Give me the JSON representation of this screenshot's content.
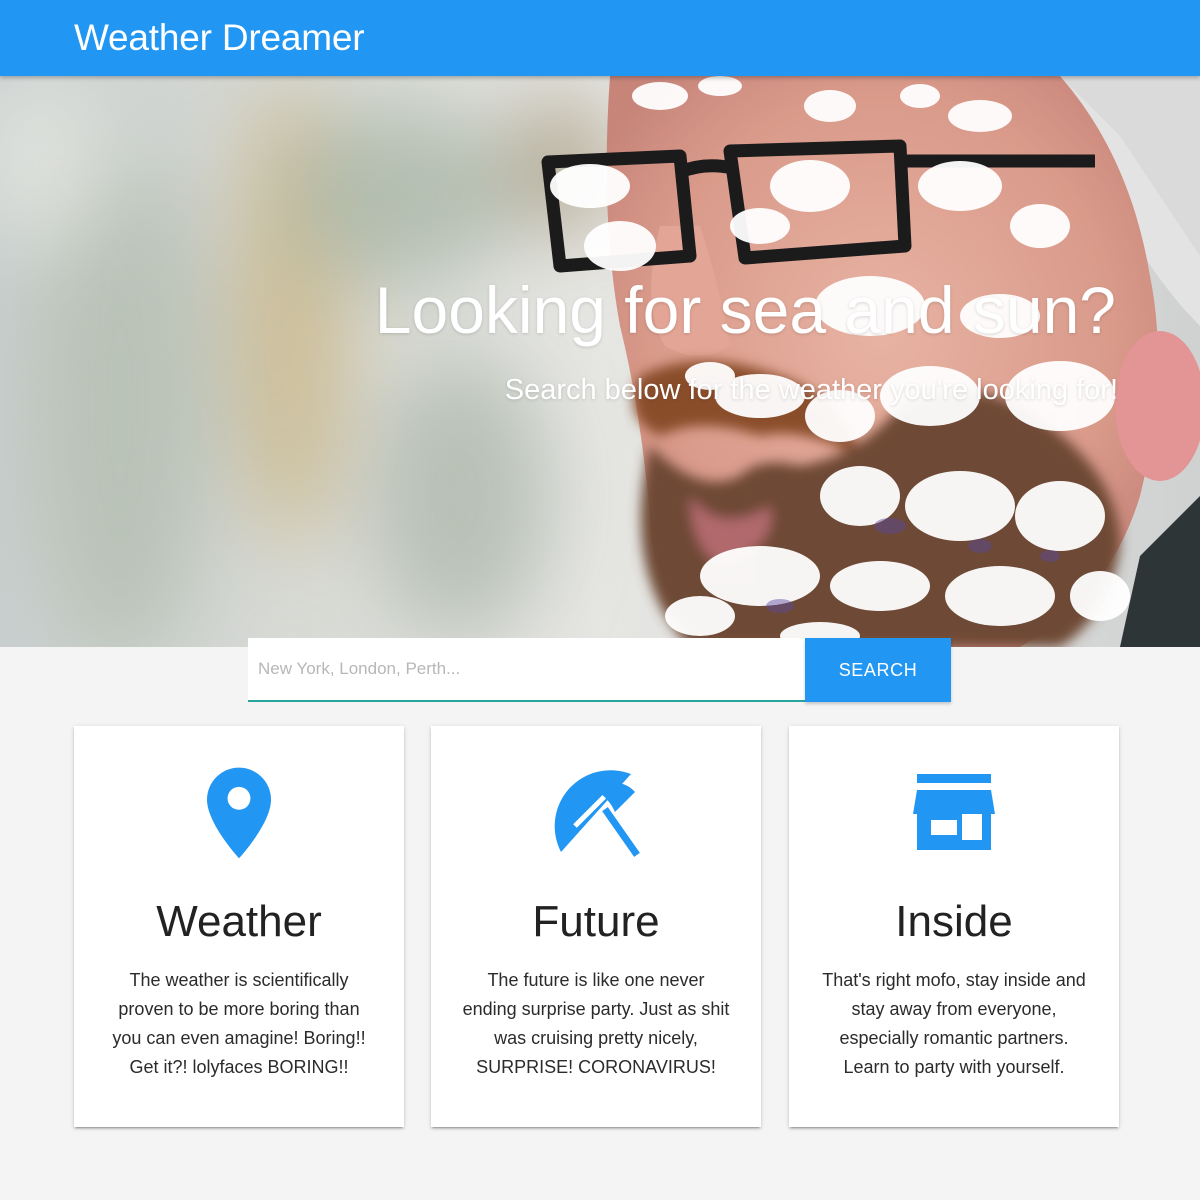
{
  "navbar": {
    "brand": "Weather Dreamer",
    "accent_color": "#2196f3"
  },
  "hero": {
    "title": "Looking for sea and sun?",
    "subtitle": "Search below for the weather you're looking for!"
  },
  "search": {
    "placeholder": "New York, London, Perth...",
    "value": "",
    "button_label": "SEARCH"
  },
  "cards": [
    {
      "icon": "location-pin-icon",
      "title": "Weather",
      "text": "The weather is scientifically proven to be more boring than you can even amagine! Boring!! Get it?! lolyfaces BORING!!"
    },
    {
      "icon": "beach-umbrella-icon",
      "title": "Future",
      "text": "The future is like one never ending surprise party. Just as shit was cruising pretty nicely, SURPRISE! CORONAVIRUS!"
    },
    {
      "icon": "store-icon",
      "title": "Inside",
      "text": "That's right mofo, stay inside and stay away from everyone, especially romantic partners. Learn to party with yourself."
    }
  ]
}
